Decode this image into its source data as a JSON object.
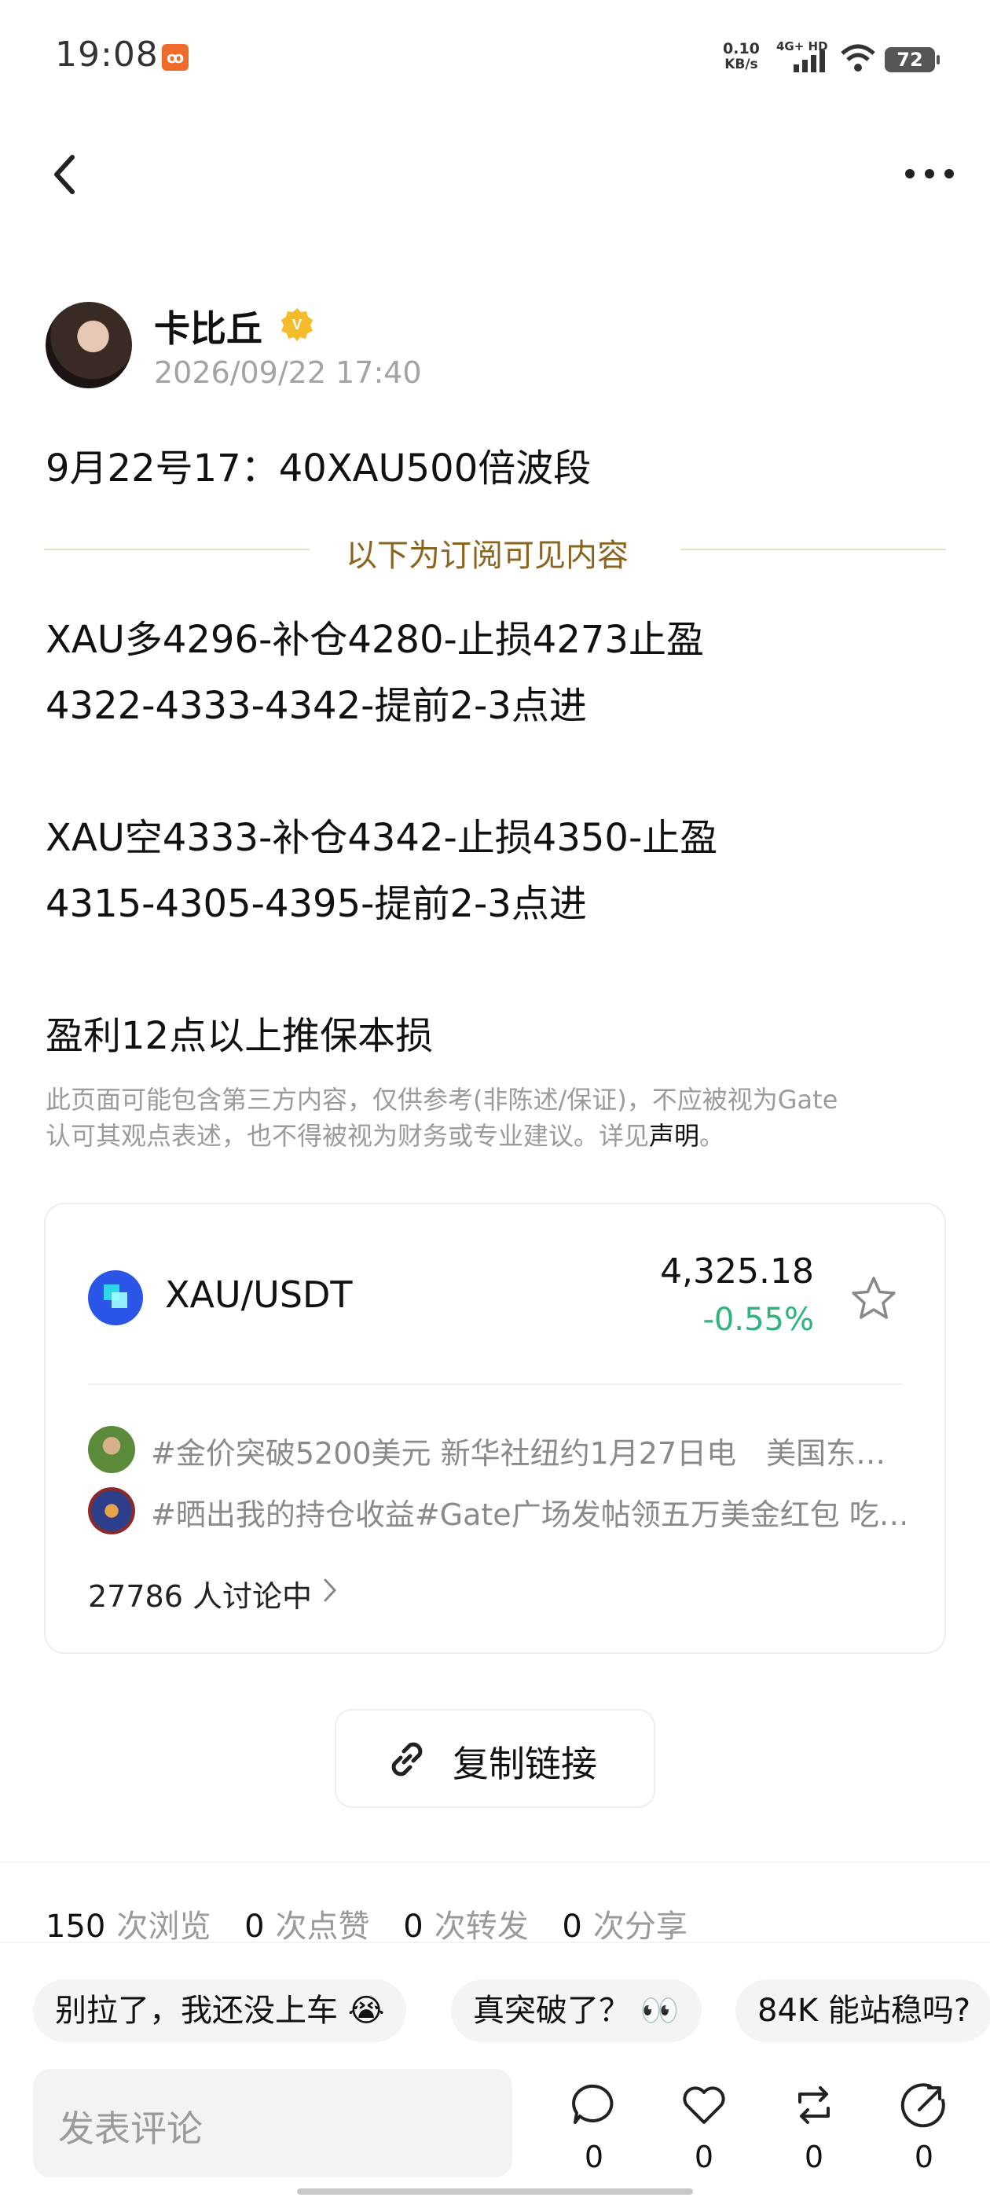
{
  "status_bar": {
    "time": "19:08",
    "net_speed_value": "0.10",
    "net_speed_unit": "KB/s",
    "network": "4G+ HD",
    "battery": "72"
  },
  "post": {
    "author": "卡比丘",
    "date": "2026/09/22 17:40",
    "title": "9月22号17：40XAU500倍波段",
    "subscription_divider": "以下为订阅可见内容",
    "lines": [
      "XAU多4296-补仓4280-止损4273止盈",
      "4322-4333-4342-提前2-3点进",
      "",
      "XAU空4333-补仓4342-止损4350-止盈",
      "4315-4305-4395-提前2-3点进",
      "",
      "盈利12点以上推保本损"
    ],
    "disclaimer_line1": "此页面可能包含第三方内容，仅供参考(非陈述/保证)，不应被视为Gate",
    "disclaimer_line2": "认可其观点表述，也不得被视为财务或专业建议。详见",
    "disclaimer_link": "声明",
    "disclaimer_end": "。"
  },
  "market_card": {
    "pair": "XAU/USDT",
    "price": "4,325.18",
    "change": "-0.55%",
    "change_color": "#2cb47b",
    "topics": [
      "#金价突破5200美元 新华社纽约1月27日电　美国东…",
      "#晒出我的持仓收益#Gate广场发帖领五万美金红包 吃…"
    ],
    "discussing": "27786 人讨论中"
  },
  "copy_link_label": "复制链接",
  "stats": [
    {
      "num": "150",
      "label": "次浏览"
    },
    {
      "num": "0",
      "label": "次点赞"
    },
    {
      "num": "0",
      "label": "次转发"
    },
    {
      "num": "0",
      "label": "次分享"
    }
  ],
  "quick_replies": [
    "别拉了，我还没上车 😭",
    "真突破了？ 👀",
    "84K 能站稳吗?"
  ],
  "bottom_bar": {
    "comment_placeholder": "发表评论",
    "comments": "0",
    "likes": "0",
    "reposts": "0",
    "shares": "0"
  }
}
